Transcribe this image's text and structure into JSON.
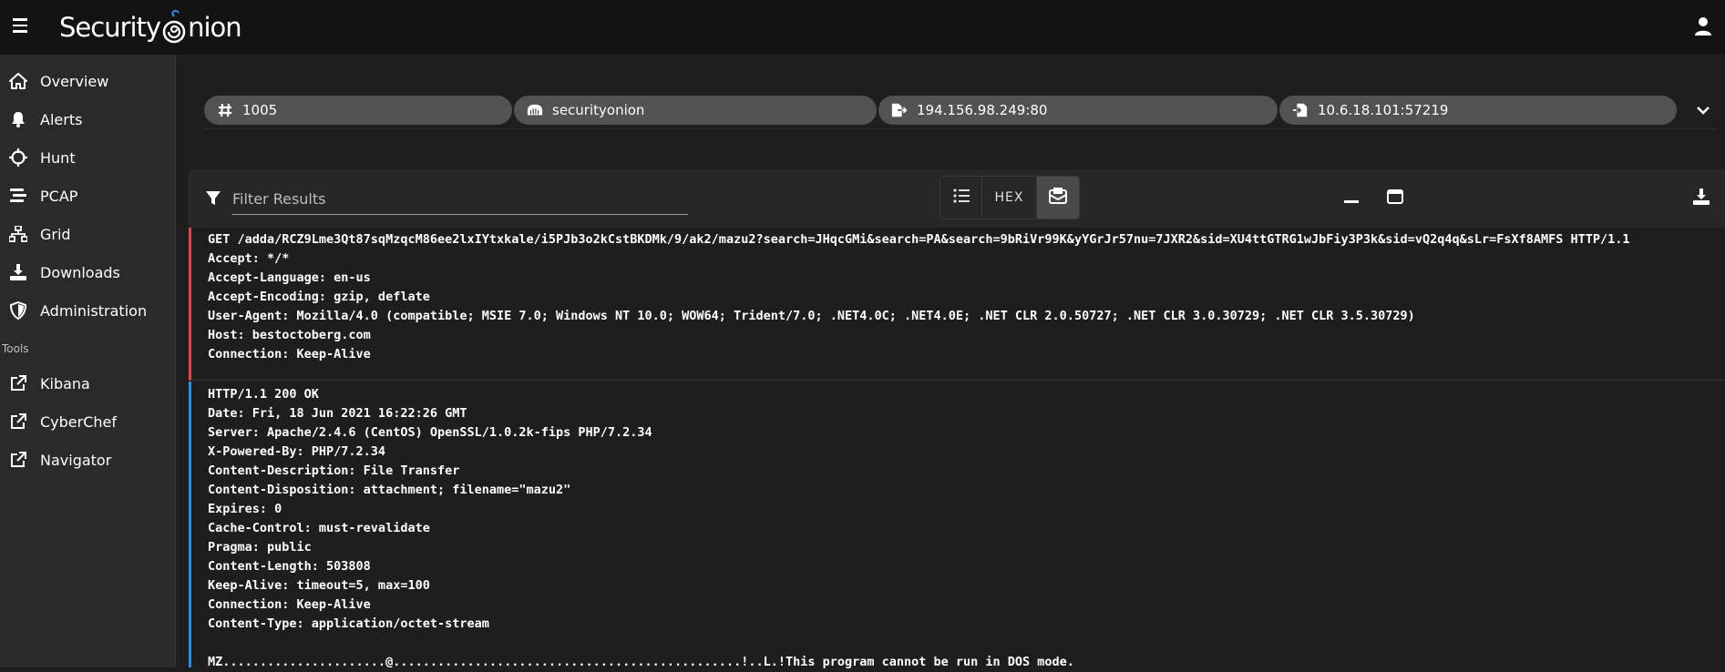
{
  "app": {
    "logo_text": "Security",
    "logo_text_end": "nion"
  },
  "sidebar": {
    "items": [
      {
        "label": "Overview",
        "icon": "home-icon"
      },
      {
        "label": "Alerts",
        "icon": "bell-icon"
      },
      {
        "label": "Hunt",
        "icon": "crosshairs-icon"
      },
      {
        "label": "PCAP",
        "icon": "stream-icon"
      },
      {
        "label": "Grid",
        "icon": "network-icon"
      },
      {
        "label": "Downloads",
        "icon": "download-icon"
      },
      {
        "label": "Administration",
        "icon": "shield-icon"
      }
    ],
    "tools_label": "Tools",
    "tools": [
      {
        "label": "Kibana",
        "icon": "external-link-icon"
      },
      {
        "label": "CyberChef",
        "icon": "external-link-icon"
      },
      {
        "label": "Navigator",
        "icon": "external-link-icon"
      }
    ]
  },
  "chips": [
    {
      "text": "1005",
      "icon": "hashtag-icon"
    },
    {
      "text": "securityonion",
      "icon": "server-icon"
    },
    {
      "text": "194.156.98.249:80",
      "icon": "file-export-icon"
    },
    {
      "text": "10.6.18.101:57219",
      "icon": "file-import-icon"
    }
  ],
  "filter": {
    "placeholder": "Filter Results"
  },
  "view_buttons": {
    "hex_label": "HEX"
  },
  "request_lines": [
    "GET /adda/RCZ9Lme3Qt87sqMzqcM86ee2lxIYtxkale/i5PJb3o2kCstBKDMk/9/ak2/mazu2?search=JHqcGMi&search=PA&search=9bRiVr99K&yYGrJr57nu=7JXR2&sid=XU4ttGTRG1wJbFiy3P3k&sid=vQ2q4q&sLr=FsXf8AMFS HTTP/1.1",
    "Accept: */*",
    "Accept-Language: en-us",
    "Accept-Encoding: gzip, deflate",
    "User-Agent: Mozilla/4.0 (compatible; MSIE 7.0; Windows NT 10.0; WOW64; Trident/7.0; .NET4.0C; .NET4.0E; .NET CLR 2.0.50727; .NET CLR 3.0.30729; .NET CLR 3.5.30729)",
    "Host: bestoctoberg.com",
    "Connection: Keep-Alive"
  ],
  "response_lines": [
    "HTTP/1.1 200 OK",
    "Date: Fri, 18 Jun 2021 16:22:26 GMT",
    "Server: Apache/2.4.6 (CentOS) OpenSSL/1.0.2k-fips PHP/7.2.34",
    "X-Powered-By: PHP/7.2.34",
    "Content-Description: File Transfer",
    "Content-Disposition: attachment; filename=\"mazu2\"",
    "Expires: 0",
    "Cache-Control: must-revalidate",
    "Pragma: public",
    "Content-Length: 503808",
    "Keep-Alive: timeout=5, max=100",
    "Connection: Keep-Alive",
    "Content-Type: application/octet-stream",
    "",
    "MZ......................@...............................................!..L.!This program cannot be run in DOS mode."
  ],
  "colors": {
    "request_border": "#e0474c",
    "response_border": "#2d8ce6",
    "logo_accent": "#2d8ce6"
  }
}
